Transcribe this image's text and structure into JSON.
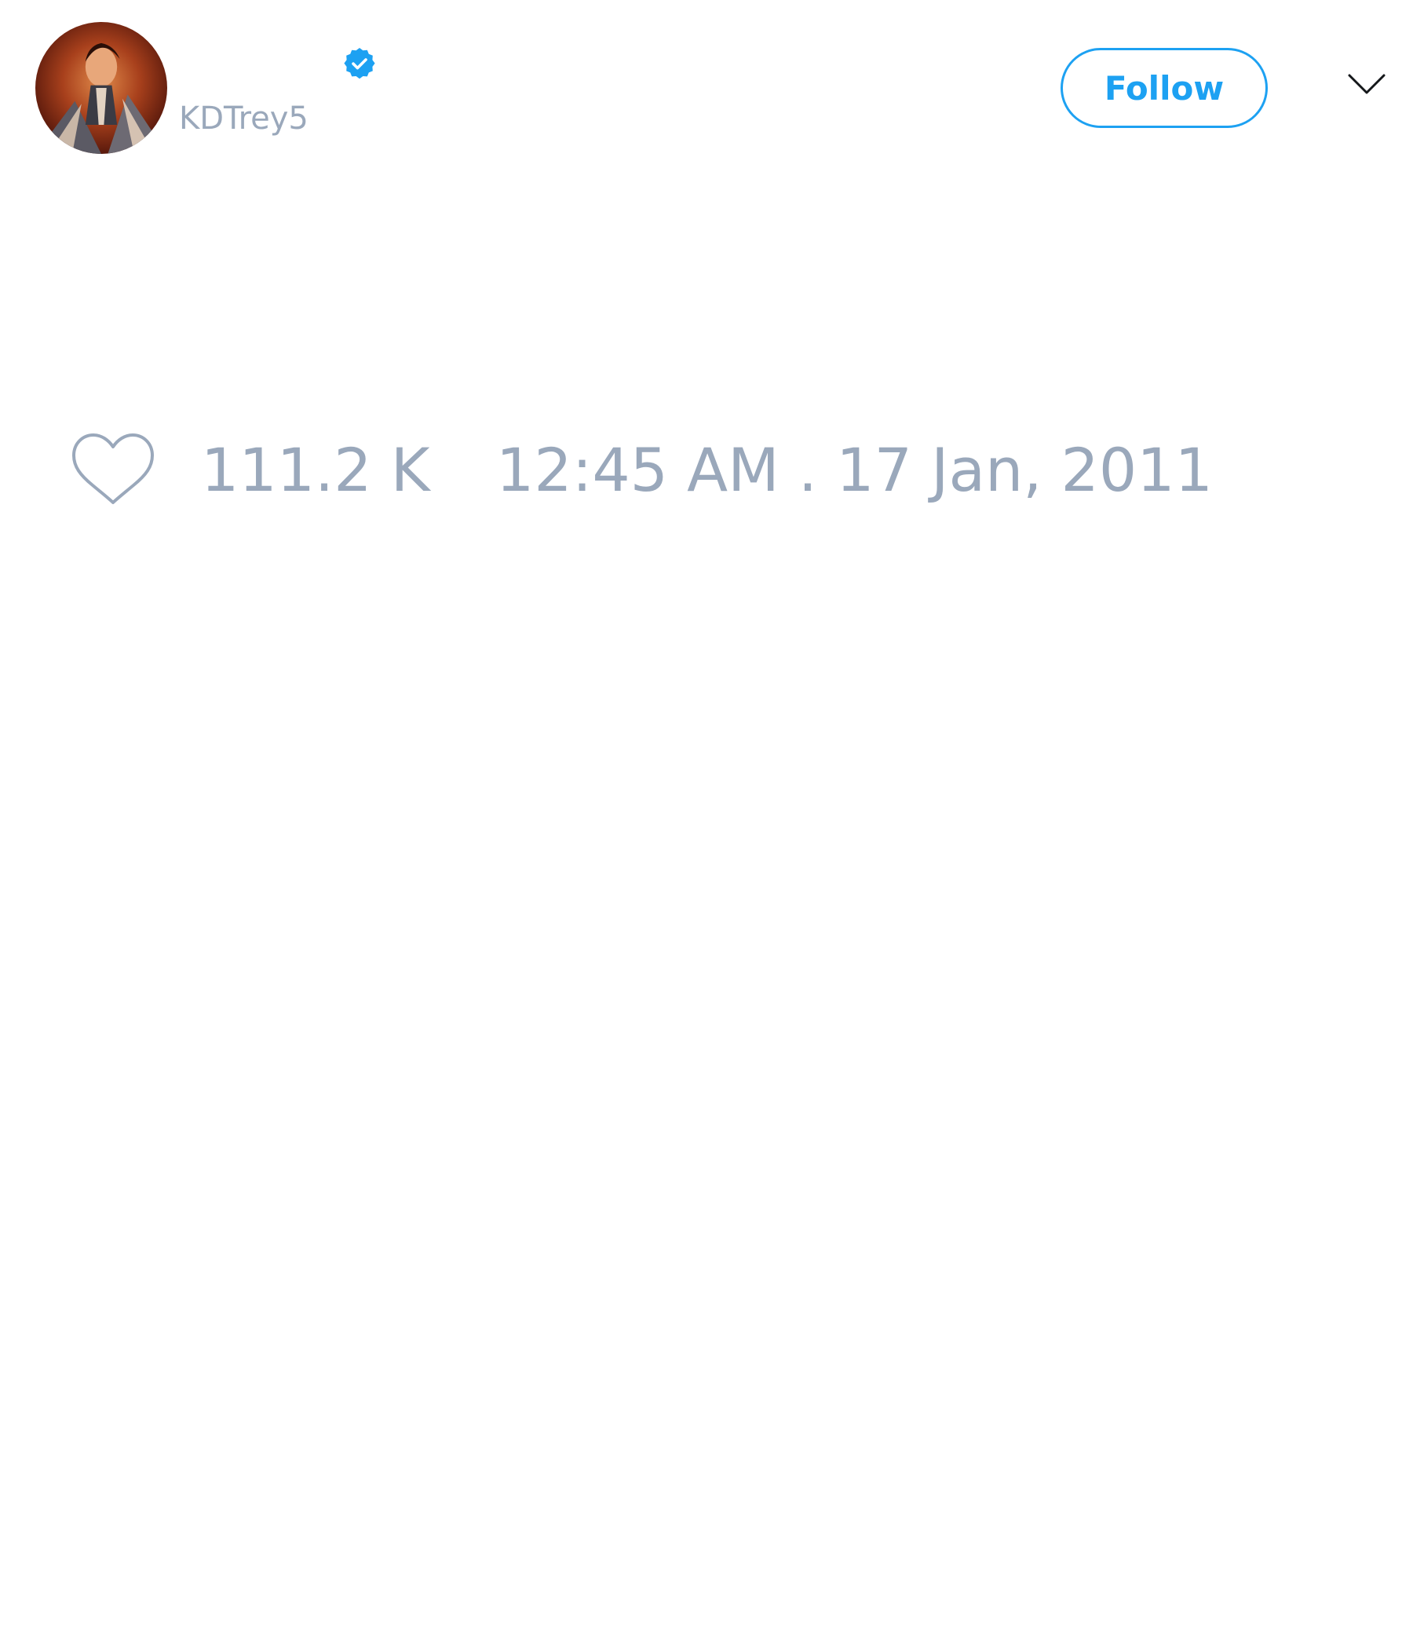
{
  "tweet": {
    "author": {
      "display_name": "",
      "handle": "KDTrey5",
      "verified": true,
      "avatar_icon": "user-avatar"
    },
    "follow_label": "Follow",
    "menu_icon": "chevron-down-icon",
    "likes": {
      "icon": "heart-icon",
      "count": "111.2 K"
    },
    "timestamp": "12:45 AM . 17 Jan, 2011"
  },
  "colors": {
    "accent": "#1da1f2",
    "muted_text": "#9aa8bb",
    "background": "#ffffff"
  }
}
